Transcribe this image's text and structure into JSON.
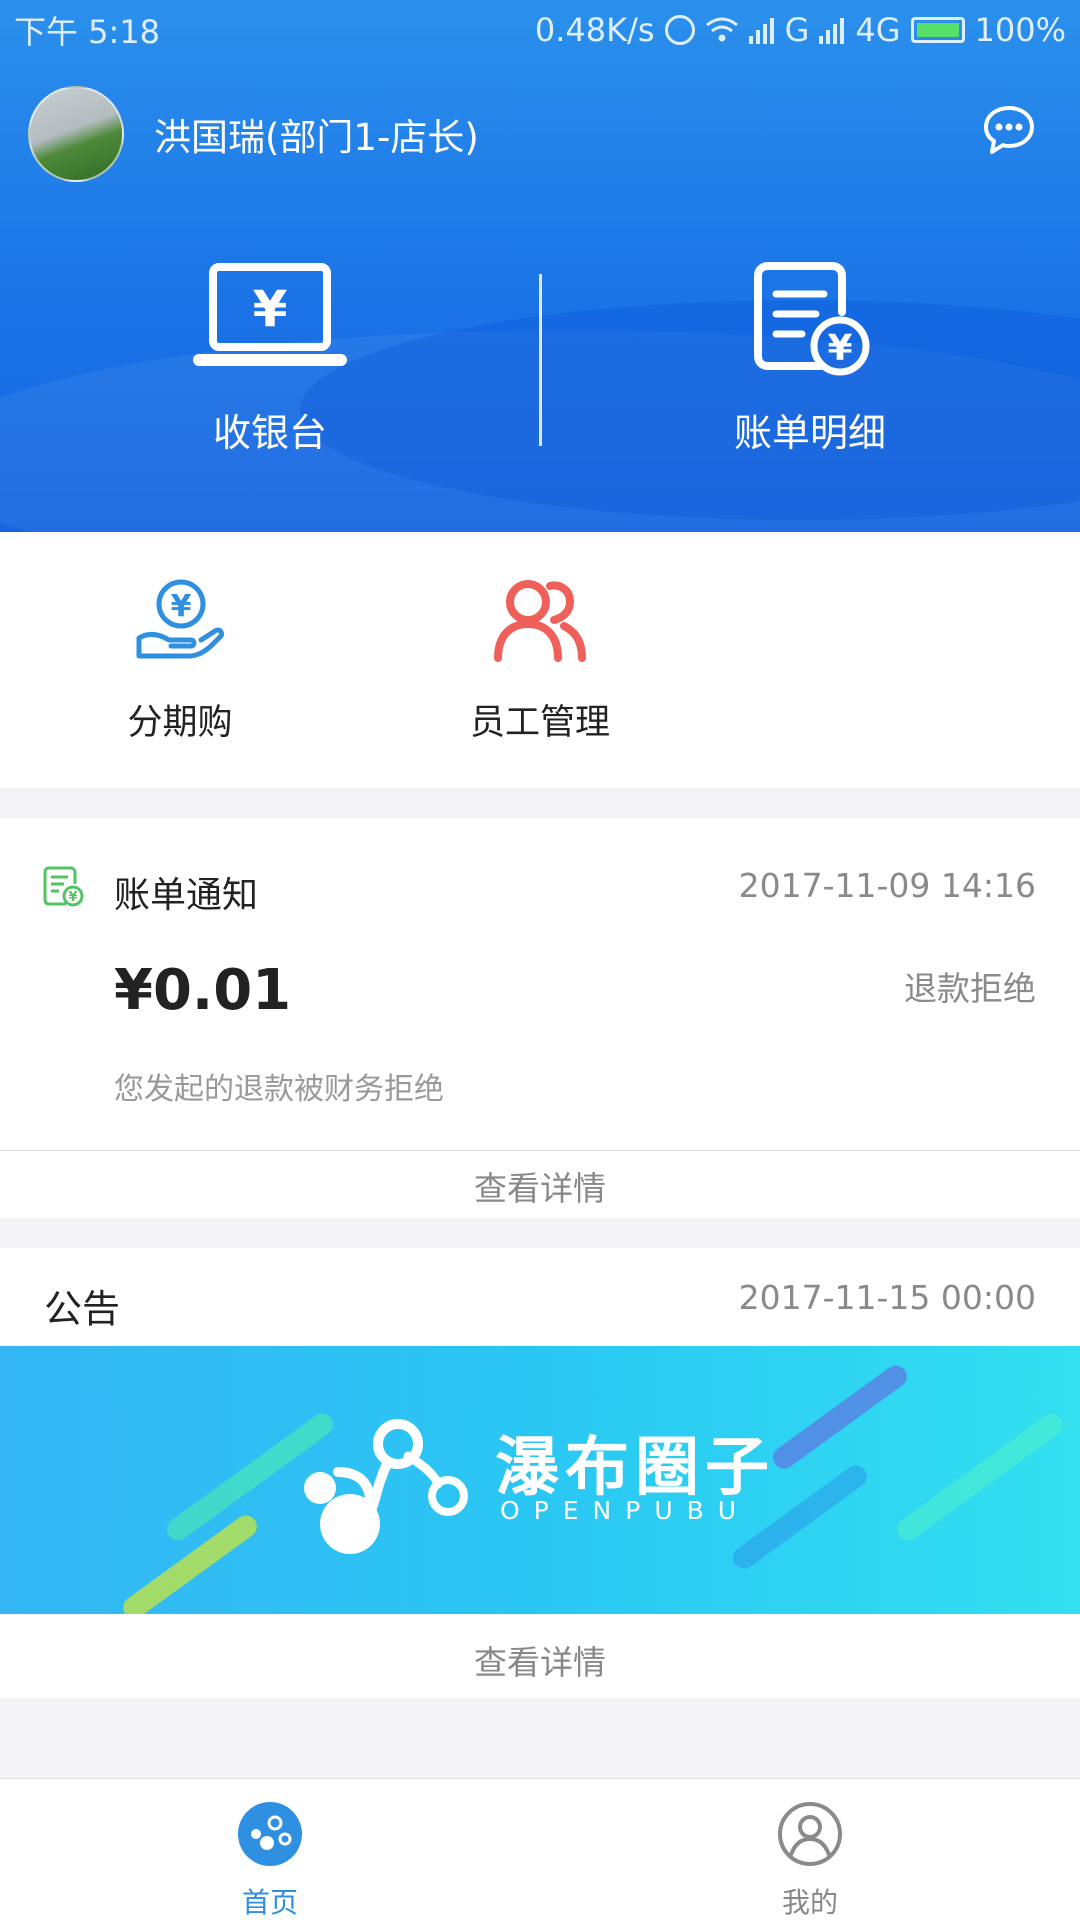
{
  "status_bar": {
    "time": "下午 5:18",
    "net_speed": "0.48K/s",
    "signal_text": "G",
    "network": "4G",
    "battery": "100%"
  },
  "header": {
    "username": "洪国瑞(部门1-店长)",
    "chat_icon": "chat-bubble-icon",
    "quick_actions": [
      {
        "label": "收银台",
        "icon": "cashier-laptop-icon"
      },
      {
        "label": "账单明细",
        "icon": "bill-detail-icon"
      }
    ]
  },
  "quick_menu": [
    {
      "label": "分期购",
      "icon": "installment-hand-coin-icon",
      "color": "#2f8fe0"
    },
    {
      "label": "员工管理",
      "icon": "staff-people-icon",
      "color": "#f0605a"
    }
  ],
  "bill_notice": {
    "title": "账单通知",
    "time": "2017-11-09 14:16",
    "amount": "¥0.01",
    "status": "退款拒绝",
    "description": "您发起的退款被财务拒绝",
    "link": "查看详情"
  },
  "announcement": {
    "title": "公告",
    "time": "2017-11-15 00:00",
    "banner_cn": "瀑布圈子",
    "banner_en": "OPENPUBU",
    "link": "查看详情"
  },
  "bottom_nav": [
    {
      "label": "首页",
      "icon": "home-bubbles-icon",
      "active": true
    },
    {
      "label": "我的",
      "icon": "profile-icon",
      "active": false
    }
  ],
  "colors": {
    "primary": "#1a72e6",
    "active_tab": "#2f8fe0",
    "inactive_tab": "#888888"
  }
}
